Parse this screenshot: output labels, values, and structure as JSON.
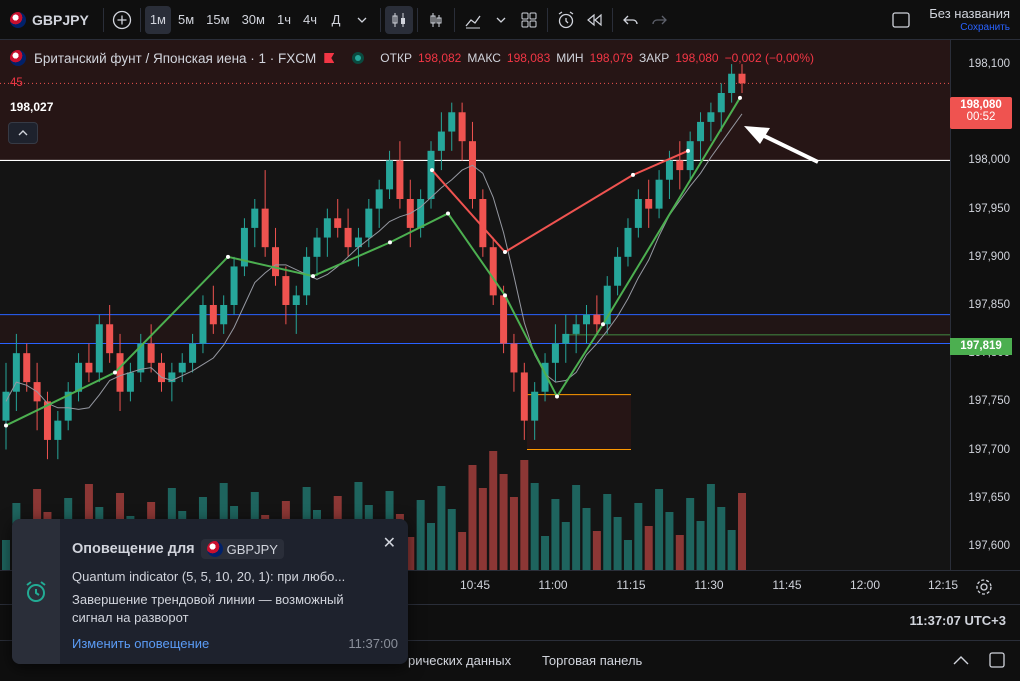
{
  "toolbar": {
    "symbol": "GBPJPY",
    "intervals": [
      "1м",
      "5м",
      "15м",
      "30м",
      "1ч",
      "4ч",
      "Д"
    ],
    "active_interval": "1м",
    "layout_name": "Без названия",
    "layout_save": "Сохранить"
  },
  "legend": {
    "title": "Британский фунт / Японская иена · 1 · FXCM",
    "open_label": "ОТКР",
    "open": "198,082",
    "high_label": "МАКС",
    "high": "198,083",
    "low_label": "МИН",
    "low": "198,079",
    "close_label": "ЗАКР",
    "close": "198,080",
    "change": "−0,002 (−0,00%)",
    "indicator_value": "45",
    "crosshair_price": "198,027"
  },
  "price_axis": {
    "ticks": [
      "198,100",
      "198,050",
      "198,000",
      "197,950",
      "197,900",
      "197,850",
      "197,800",
      "197,750",
      "197,700",
      "197,650",
      "197,600"
    ],
    "current_price": "198,080",
    "countdown": "00:52",
    "line_price": "197,819"
  },
  "time_axis": {
    "ticks": [
      "10:45",
      "11:00",
      "11:15",
      "11:30",
      "11:45",
      "12:00",
      "12:15"
    ],
    "timezone": "11:37:07 UTC+3"
  },
  "bottom_tabs": [
    "рических данных",
    "Торговая панель"
  ],
  "alert": {
    "title": "Оповещение для",
    "symbol": "GBPJPY",
    "line1": "Quantum indicator (5, 5, 10, 20, 1): при любо...",
    "line2": "Завершение трендовой линии — возможный",
    "line3": "сигнал на разворот",
    "link": "Изменить оповещение",
    "time": "11:37:00"
  },
  "colors": {
    "up": "#26a69a",
    "down": "#ef5350",
    "background": "#141414",
    "accent_blue": "#2962ff",
    "current_price_badge": "#ef5350",
    "line_badge": "#4caf50"
  },
  "chart_data": {
    "type": "candlestick",
    "ylim": [
      197.575,
      198.125
    ],
    "x_ticks": [
      "10:45",
      "11:00",
      "11:15",
      "11:30",
      "11:45",
      "12:00",
      "12:15"
    ],
    "horizontal_lines": [
      198.0,
      197.819
    ],
    "current_price": 198.08,
    "candles": [
      [
        197.73,
        197.79,
        197.7,
        197.76
      ],
      [
        197.76,
        197.82,
        197.74,
        197.8
      ],
      [
        197.8,
        197.81,
        197.76,
        197.77
      ],
      [
        197.77,
        197.79,
        197.72,
        197.75
      ],
      [
        197.75,
        197.76,
        197.69,
        197.71
      ],
      [
        197.71,
        197.74,
        197.69,
        197.73
      ],
      [
        197.73,
        197.77,
        197.72,
        197.76
      ],
      [
        197.76,
        197.8,
        197.75,
        197.79
      ],
      [
        197.79,
        197.81,
        197.77,
        197.78
      ],
      [
        197.78,
        197.84,
        197.77,
        197.83
      ],
      [
        197.83,
        197.85,
        197.79,
        197.8
      ],
      [
        197.8,
        197.82,
        197.74,
        197.76
      ],
      [
        197.76,
        197.79,
        197.75,
        197.78
      ],
      [
        197.78,
        197.82,
        197.77,
        197.81
      ],
      [
        197.81,
        197.83,
        197.78,
        197.79
      ],
      [
        197.79,
        197.8,
        197.76,
        197.77
      ],
      [
        197.77,
        197.79,
        197.75,
        197.78
      ],
      [
        197.78,
        197.8,
        197.77,
        197.79
      ],
      [
        197.79,
        197.82,
        197.78,
        197.81
      ],
      [
        197.81,
        197.86,
        197.8,
        197.85
      ],
      [
        197.85,
        197.87,
        197.82,
        197.83
      ],
      [
        197.83,
        197.86,
        197.82,
        197.85
      ],
      [
        197.85,
        197.9,
        197.84,
        197.89
      ],
      [
        197.89,
        197.94,
        197.88,
        197.93
      ],
      [
        197.93,
        197.96,
        197.91,
        197.95
      ],
      [
        197.95,
        197.99,
        197.9,
        197.91
      ],
      [
        197.91,
        197.93,
        197.87,
        197.88
      ],
      [
        197.88,
        197.89,
        197.83,
        197.85
      ],
      [
        197.85,
        197.87,
        197.82,
        197.86
      ],
      [
        197.86,
        197.91,
        197.85,
        197.9
      ],
      [
        197.9,
        197.93,
        197.88,
        197.92
      ],
      [
        197.92,
        197.95,
        197.9,
        197.94
      ],
      [
        197.94,
        197.96,
        197.92,
        197.93
      ],
      [
        197.93,
        197.95,
        197.9,
        197.91
      ],
      [
        197.91,
        197.93,
        197.89,
        197.92
      ],
      [
        197.92,
        197.96,
        197.91,
        197.95
      ],
      [
        197.95,
        197.98,
        197.93,
        197.97
      ],
      [
        197.97,
        198.01,
        197.96,
        198.0
      ],
      [
        198.0,
        198.02,
        197.95,
        197.96
      ],
      [
        197.96,
        197.98,
        197.91,
        197.93
      ],
      [
        197.93,
        197.97,
        197.92,
        197.96
      ],
      [
        197.96,
        198.02,
        197.95,
        198.01
      ],
      [
        198.01,
        198.05,
        197.99,
        198.03
      ],
      [
        198.03,
        198.06,
        198.01,
        198.05
      ],
      [
        198.05,
        198.06,
        198.0,
        198.02
      ],
      [
        198.02,
        198.04,
        197.95,
        197.96
      ],
      [
        197.96,
        197.97,
        197.9,
        197.91
      ],
      [
        197.91,
        197.92,
        197.85,
        197.86
      ],
      [
        197.86,
        197.87,
        197.8,
        197.81
      ],
      [
        197.81,
        197.82,
        197.76,
        197.78
      ],
      [
        197.78,
        197.79,
        197.71,
        197.73
      ],
      [
        197.73,
        197.77,
        197.71,
        197.76
      ],
      [
        197.76,
        197.8,
        197.75,
        197.79
      ],
      [
        197.79,
        197.83,
        197.77,
        197.81
      ],
      [
        197.81,
        197.84,
        197.79,
        197.82
      ],
      [
        197.82,
        197.84,
        197.8,
        197.83
      ],
      [
        197.83,
        197.85,
        197.81,
        197.84
      ],
      [
        197.84,
        197.86,
        197.82,
        197.83
      ],
      [
        197.83,
        197.88,
        197.82,
        197.87
      ],
      [
        197.87,
        197.91,
        197.86,
        197.9
      ],
      [
        197.9,
        197.94,
        197.89,
        197.93
      ],
      [
        197.93,
        197.97,
        197.92,
        197.96
      ],
      [
        197.96,
        197.98,
        197.93,
        197.95
      ],
      [
        197.95,
        197.99,
        197.94,
        197.98
      ],
      [
        197.98,
        198.01,
        197.96,
        198.0
      ],
      [
        198.0,
        198.02,
        197.97,
        197.99
      ],
      [
        197.99,
        198.03,
        197.98,
        198.02
      ],
      [
        198.02,
        198.05,
        198.0,
        198.04
      ],
      [
        198.04,
        198.06,
        198.02,
        198.05
      ],
      [
        198.05,
        198.08,
        198.03,
        198.07
      ],
      [
        198.07,
        198.1,
        198.06,
        198.09
      ],
      [
        198.09,
        198.1,
        198.07,
        198.08
      ]
    ]
  }
}
